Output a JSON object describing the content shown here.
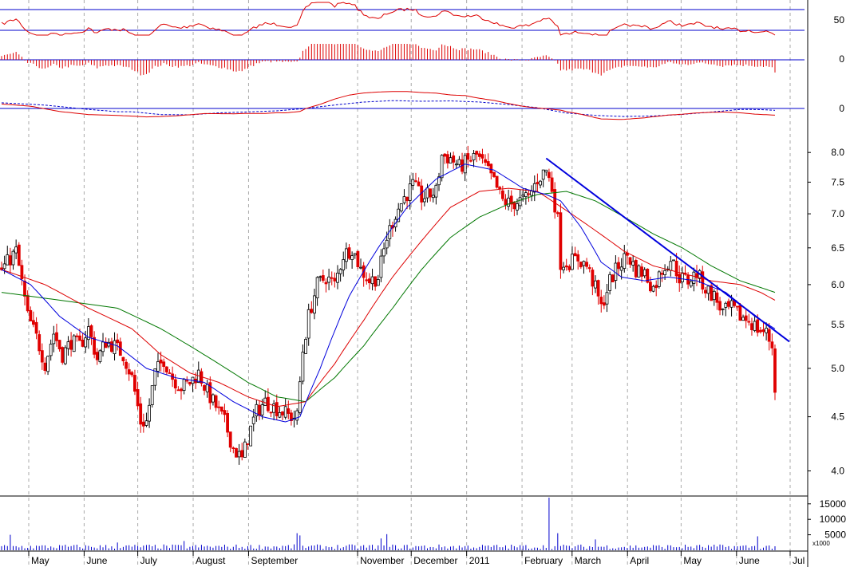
{
  "chart_data": {
    "type": "candlestick",
    "colors": {
      "up": "#000000",
      "down": "#e00000",
      "ma_fast": "#0000dd",
      "ma_mid": "#dd0000",
      "ma_slow": "#007700",
      "trendline": "#0000dd",
      "volume": "#0000cc",
      "frame": "#000000",
      "month_grid": "#aaaaaa",
      "indicator_line": "#dd0000",
      "indicator_signal": "#0000cc",
      "indicator_ref": "#0000cc"
    },
    "x_axis": {
      "ticks": [
        "May",
        "June",
        "July",
        "August",
        "September",
        "November",
        "December",
        "2011",
        "February",
        "March",
        "April",
        "May",
        "June",
        "Jul"
      ],
      "tick_days": [
        0,
        31,
        61,
        92,
        123,
        184,
        214,
        245,
        276,
        304,
        335,
        365,
        396,
        426
      ]
    },
    "price_panel": {
      "scale": "log",
      "ylim": [
        3.8,
        8.3
      ],
      "y_ticks": [
        "4.0",
        "4.5",
        "5.0",
        "5.5",
        "6.0",
        "6.5",
        "7.0",
        "7.5",
        "8.0"
      ],
      "y_tick_values": [
        4.0,
        4.5,
        5.0,
        5.5,
        6.0,
        6.5,
        7.0,
        7.5,
        8.0
      ],
      "price_anchors": [
        [
          0,
          6.2
        ],
        [
          5,
          6.45
        ],
        [
          9,
          5.6
        ],
        [
          12,
          5.35
        ],
        [
          15,
          5.05
        ],
        [
          18,
          5.4
        ],
        [
          21,
          5.15
        ],
        [
          24,
          5.3
        ],
        [
          27,
          5.25
        ],
        [
          30,
          5.45
        ],
        [
          33,
          5.1
        ],
        [
          36,
          5.3
        ],
        [
          39,
          5.25
        ],
        [
          42,
          5.15
        ],
        [
          45,
          4.9
        ],
        [
          48,
          4.45
        ],
        [
          50,
          4.45
        ],
        [
          53,
          4.95
        ],
        [
          56,
          5.1
        ],
        [
          59,
          4.9
        ],
        [
          62,
          4.8
        ],
        [
          65,
          4.85
        ],
        [
          68,
          4.95
        ],
        [
          71,
          4.75
        ],
        [
          74,
          4.6
        ],
        [
          77,
          4.45
        ],
        [
          80,
          4.2
        ],
        [
          83,
          4.1
        ],
        [
          85,
          4.3
        ],
        [
          88,
          4.55
        ],
        [
          91,
          4.65
        ],
        [
          94,
          4.6
        ],
        [
          97,
          4.55
        ],
        [
          100,
          4.5
        ],
        [
          102,
          4.5
        ],
        [
          104,
          5.2
        ],
        [
          106,
          5.6
        ],
        [
          109,
          6.0
        ],
        [
          112,
          6.1
        ],
        [
          115,
          6.0
        ],
        [
          118,
          6.4
        ],
        [
          121,
          6.5
        ],
        [
          124,
          6.2
        ],
        [
          127,
          6.05
        ],
        [
          130,
          6.1
        ],
        [
          133,
          6.65
        ],
        [
          136,
          7.0
        ],
        [
          139,
          7.25
        ],
        [
          142,
          7.45
        ],
        [
          145,
          7.25
        ],
        [
          148,
          7.3
        ],
        [
          150,
          7.35
        ],
        [
          152,
          7.95
        ],
        [
          155,
          7.9
        ],
        [
          158,
          7.75
        ],
        [
          161,
          7.85
        ],
        [
          164,
          7.95
        ],
        [
          167,
          7.75
        ],
        [
          170,
          7.5
        ],
        [
          173,
          7.2
        ],
        [
          176,
          7.15
        ],
        [
          179,
          7.2
        ],
        [
          182,
          7.25
        ],
        [
          185,
          7.55
        ],
        [
          188,
          7.7
        ],
        [
          190,
          7.4
        ],
        [
          192,
          6.9
        ],
        [
          193,
          6.3
        ],
        [
          196,
          6.3
        ],
        [
          199,
          6.35
        ],
        [
          202,
          6.25
        ],
        [
          205,
          5.95
        ],
        [
          207,
          5.7
        ],
        [
          210,
          6.05
        ],
        [
          213,
          6.25
        ],
        [
          216,
          6.4
        ],
        [
          219,
          6.2
        ],
        [
          222,
          6.15
        ],
        [
          225,
          5.95
        ],
        [
          228,
          6.2
        ],
        [
          231,
          6.35
        ],
        [
          234,
          6.1
        ],
        [
          237,
          6.05
        ],
        [
          240,
          6.15
        ],
        [
          243,
          5.95
        ],
        [
          246,
          5.85
        ],
        [
          249,
          5.65
        ],
        [
          252,
          5.7
        ],
        [
          255,
          5.6
        ],
        [
          258,
          5.55
        ],
        [
          261,
          5.45
        ],
        [
          264,
          5.4
        ],
        [
          266,
          5.25
        ],
        [
          267,
          4.8
        ]
      ],
      "ma_fast_anchors": [
        [
          0,
          6.2
        ],
        [
          10,
          6.0
        ],
        [
          20,
          5.6
        ],
        [
          30,
          5.35
        ],
        [
          40,
          5.25
        ],
        [
          50,
          5.0
        ],
        [
          60,
          4.9
        ],
        [
          70,
          4.85
        ],
        [
          80,
          4.65
        ],
        [
          90,
          4.5
        ],
        [
          98,
          4.45
        ],
        [
          103,
          4.5
        ],
        [
          110,
          5.0
        ],
        [
          120,
          5.85
        ],
        [
          130,
          6.5
        ],
        [
          140,
          7.1
        ],
        [
          150,
          7.55
        ],
        [
          160,
          7.8
        ],
        [
          170,
          7.7
        ],
        [
          180,
          7.4
        ],
        [
          188,
          7.3
        ],
        [
          193,
          7.2
        ],
        [
          200,
          6.8
        ],
        [
          207,
          6.3
        ],
        [
          214,
          6.1
        ],
        [
          222,
          6.05
        ],
        [
          230,
          6.1
        ],
        [
          240,
          6.05
        ],
        [
          250,
          5.9
        ],
        [
          260,
          5.6
        ],
        [
          267,
          5.45
        ]
      ],
      "ma_mid_anchors": [
        [
          0,
          6.2
        ],
        [
          15,
          6.0
        ],
        [
          30,
          5.7
        ],
        [
          45,
          5.45
        ],
        [
          55,
          5.15
        ],
        [
          65,
          4.95
        ],
        [
          75,
          4.85
        ],
        [
          85,
          4.7
        ],
        [
          95,
          4.6
        ],
        [
          105,
          4.65
        ],
        [
          115,
          5.05
        ],
        [
          125,
          5.55
        ],
        [
          135,
          6.1
        ],
        [
          145,
          6.6
        ],
        [
          155,
          7.1
        ],
        [
          165,
          7.35
        ],
        [
          175,
          7.4
        ],
        [
          185,
          7.35
        ],
        [
          195,
          7.05
        ],
        [
          205,
          6.75
        ],
        [
          215,
          6.45
        ],
        [
          225,
          6.25
        ],
        [
          235,
          6.15
        ],
        [
          245,
          6.05
        ],
        [
          255,
          6.0
        ],
        [
          262,
          5.9
        ],
        [
          267,
          5.8
        ]
      ],
      "ma_slow_anchors": [
        [
          0,
          5.9
        ],
        [
          20,
          5.8
        ],
        [
          40,
          5.7
        ],
        [
          55,
          5.45
        ],
        [
          65,
          5.25
        ],
        [
          75,
          5.05
        ],
        [
          85,
          4.85
        ],
        [
          95,
          4.7
        ],
        [
          105,
          4.65
        ],
        [
          115,
          4.9
        ],
        [
          125,
          5.25
        ],
        [
          135,
          5.7
        ],
        [
          145,
          6.2
        ],
        [
          155,
          6.65
        ],
        [
          165,
          6.95
        ],
        [
          175,
          7.15
        ],
        [
          185,
          7.3
        ],
        [
          195,
          7.35
        ],
        [
          205,
          7.2
        ],
        [
          215,
          6.95
        ],
        [
          225,
          6.7
        ],
        [
          235,
          6.5
        ],
        [
          245,
          6.25
        ],
        [
          255,
          6.05
        ],
        [
          267,
          5.9
        ]
      ],
      "trendline": [
        [
          188,
          7.9
        ],
        [
          272,
          5.3
        ]
      ]
    },
    "volume_panel": {
      "y_ticks": [
        "15000",
        "10000",
        "5000"
      ],
      "y_tick_values": [
        15000,
        10000,
        5000
      ],
      "ylim": [
        0,
        17000
      ],
      "multiplier_label": "x1000",
      "spikes": [
        [
          3,
          5000
        ],
        [
          40,
          2500
        ],
        [
          63,
          3000
        ],
        [
          102,
          5500
        ],
        [
          103,
          4800
        ],
        [
          131,
          3800
        ],
        [
          133,
          5200
        ],
        [
          189,
          17000
        ],
        [
          192,
          5500
        ],
        [
          205,
          3500
        ],
        [
          261,
          4500
        ]
      ]
    },
    "indicator_panels": [
      {
        "label": "50",
        "type": "line"
      },
      {
        "label": "0",
        "type": "histogram"
      },
      {
        "label": "0",
        "type": "line_with_signal"
      }
    ]
  }
}
